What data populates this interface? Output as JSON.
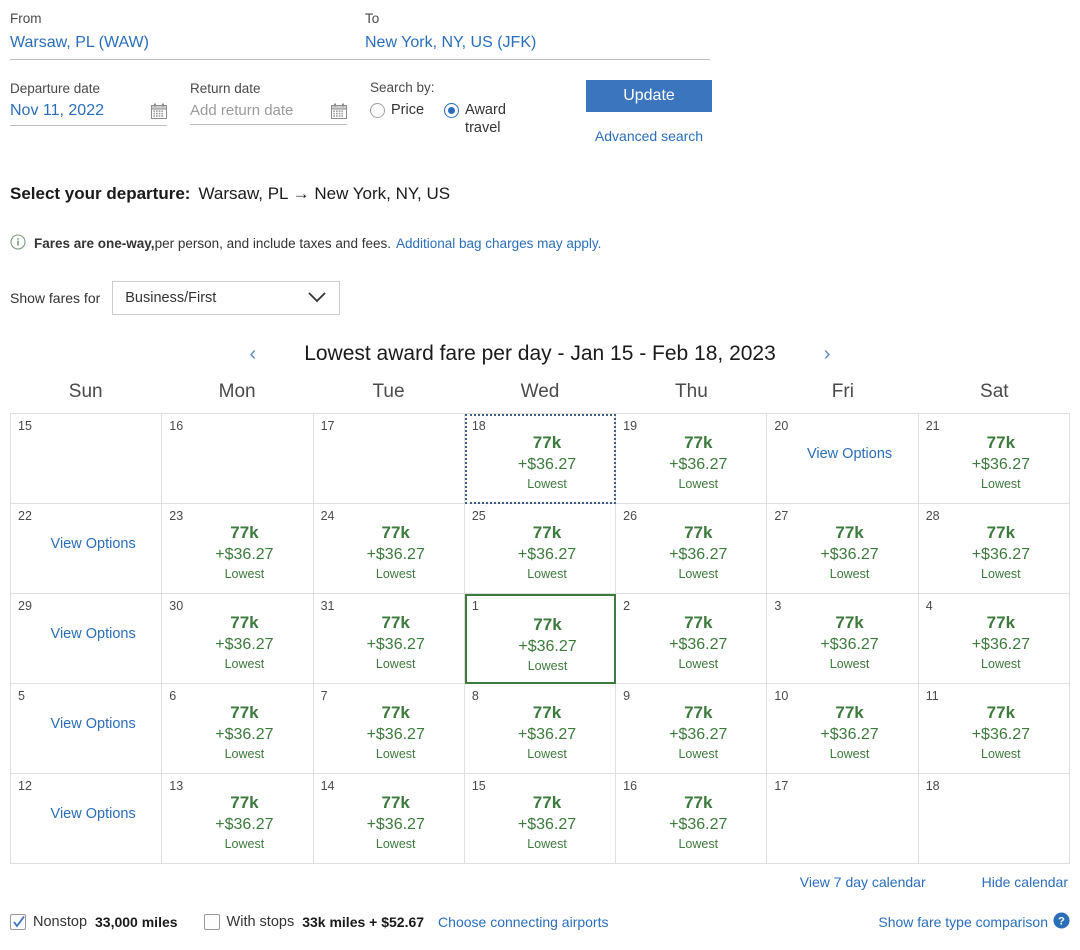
{
  "search": {
    "from_label": "From",
    "from_value": "Warsaw, PL (WAW)",
    "to_label": "To",
    "to_value": "New York, NY, US (JFK)",
    "departure_label": "Departure date",
    "departure_value": "Nov 11, 2022",
    "return_label": "Return date",
    "return_placeholder": "Add return date",
    "searchby_label": "Search by:",
    "radio_price": "Price",
    "radio_award": "Award travel",
    "selected_search_by": "Award travel",
    "update_button": "Update",
    "advanced_search": "Advanced search"
  },
  "heading": {
    "title": "Select your departure:",
    "route": "Warsaw, PL → New York, NY, US"
  },
  "note": {
    "bold": "Fares are one-way,",
    "rest": " per person, and include taxes and fees.",
    "link": "Additional bag charges may apply."
  },
  "fare_filter": {
    "label": "Show fares for",
    "selected": "Business/First",
    "options": [
      "Business/First"
    ]
  },
  "calendar": {
    "prev_arrow": "‹",
    "next_arrow": "›",
    "title": "Lowest award fare per day - Jan 15 - Feb 18, 2023",
    "weekdays": [
      "Sun",
      "Mon",
      "Tue",
      "Wed",
      "Thu",
      "Fri",
      "Sat"
    ],
    "view_options_label": "View Options",
    "lowest_label": "Lowest",
    "miles_value": "77k",
    "price_value": "+$36.27",
    "cells": [
      {
        "day": "15",
        "type": "empty"
      },
      {
        "day": "16",
        "type": "empty"
      },
      {
        "day": "17",
        "type": "empty"
      },
      {
        "day": "18",
        "type": "fare",
        "state": "focused"
      },
      {
        "day": "19",
        "type": "fare"
      },
      {
        "day": "20",
        "type": "options"
      },
      {
        "day": "21",
        "type": "fare"
      },
      {
        "day": "22",
        "type": "options"
      },
      {
        "day": "23",
        "type": "fare"
      },
      {
        "day": "24",
        "type": "fare"
      },
      {
        "day": "25",
        "type": "fare"
      },
      {
        "day": "26",
        "type": "fare"
      },
      {
        "day": "27",
        "type": "fare"
      },
      {
        "day": "28",
        "type": "fare"
      },
      {
        "day": "29",
        "type": "options"
      },
      {
        "day": "30",
        "type": "fare"
      },
      {
        "day": "31",
        "type": "fare"
      },
      {
        "day": "1",
        "type": "fare",
        "state": "selected"
      },
      {
        "day": "2",
        "type": "fare"
      },
      {
        "day": "3",
        "type": "fare"
      },
      {
        "day": "4",
        "type": "fare"
      },
      {
        "day": "5",
        "type": "options"
      },
      {
        "day": "6",
        "type": "fare"
      },
      {
        "day": "7",
        "type": "fare"
      },
      {
        "day": "8",
        "type": "fare"
      },
      {
        "day": "9",
        "type": "fare"
      },
      {
        "day": "10",
        "type": "fare"
      },
      {
        "day": "11",
        "type": "fare"
      },
      {
        "day": "12",
        "type": "options"
      },
      {
        "day": "13",
        "type": "fare"
      },
      {
        "day": "14",
        "type": "fare"
      },
      {
        "day": "15",
        "type": "fare"
      },
      {
        "day": "16",
        "type": "fare"
      },
      {
        "day": "17",
        "type": "empty"
      },
      {
        "day": "18",
        "type": "empty"
      }
    ]
  },
  "calendar_links": {
    "view_7_day": "View 7 day calendar",
    "hide_calendar": "Hide calendar"
  },
  "filters": {
    "nonstop_label": "Nonstop",
    "nonstop_value": "33,000 miles",
    "nonstop_checked": true,
    "withstops_label": "With stops",
    "withstops_value": "33k miles + $52.67",
    "withstops_checked": false,
    "choose_airports": "Choose connecting airports",
    "fare_comparison": "Show fare type comparison"
  },
  "colors": {
    "link_blue": "#2a6ebb",
    "button_blue": "#3a75bd",
    "fare_green": "#3d7a3d",
    "selected_border": "#3d7a3d",
    "focus_border": "#3f5f86"
  }
}
